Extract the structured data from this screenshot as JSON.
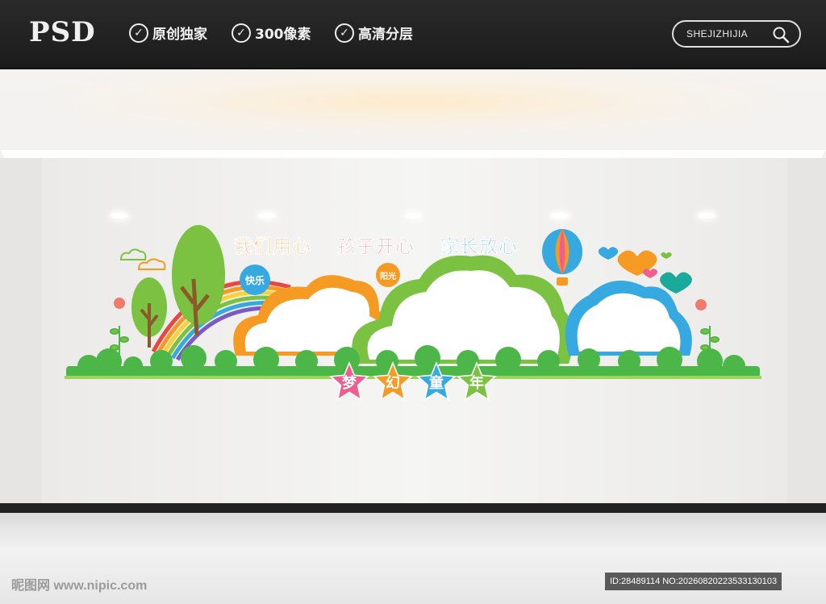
{
  "header": {
    "brand": "PSD",
    "badges": [
      "原创独家",
      "300像素",
      "高清分层"
    ],
    "search_label": "SHEJIZHIJIA"
  },
  "mural": {
    "slogan": [
      "我们用心",
      "孩子开心",
      "家长放心"
    ],
    "bubbles": [
      "快乐",
      "阳光"
    ],
    "title_chars": [
      "梦",
      "幻",
      "童",
      "年"
    ]
  },
  "watermark": {
    "left": "昵图网 www.nipic.com",
    "right": "ID:28489114 NO:20260820223533130103"
  },
  "colors": {
    "orange": "#f59a23",
    "green": "#7cc242",
    "blue": "#35a9e0",
    "pink": "#ec5f8e",
    "grass": "#4cb748"
  }
}
